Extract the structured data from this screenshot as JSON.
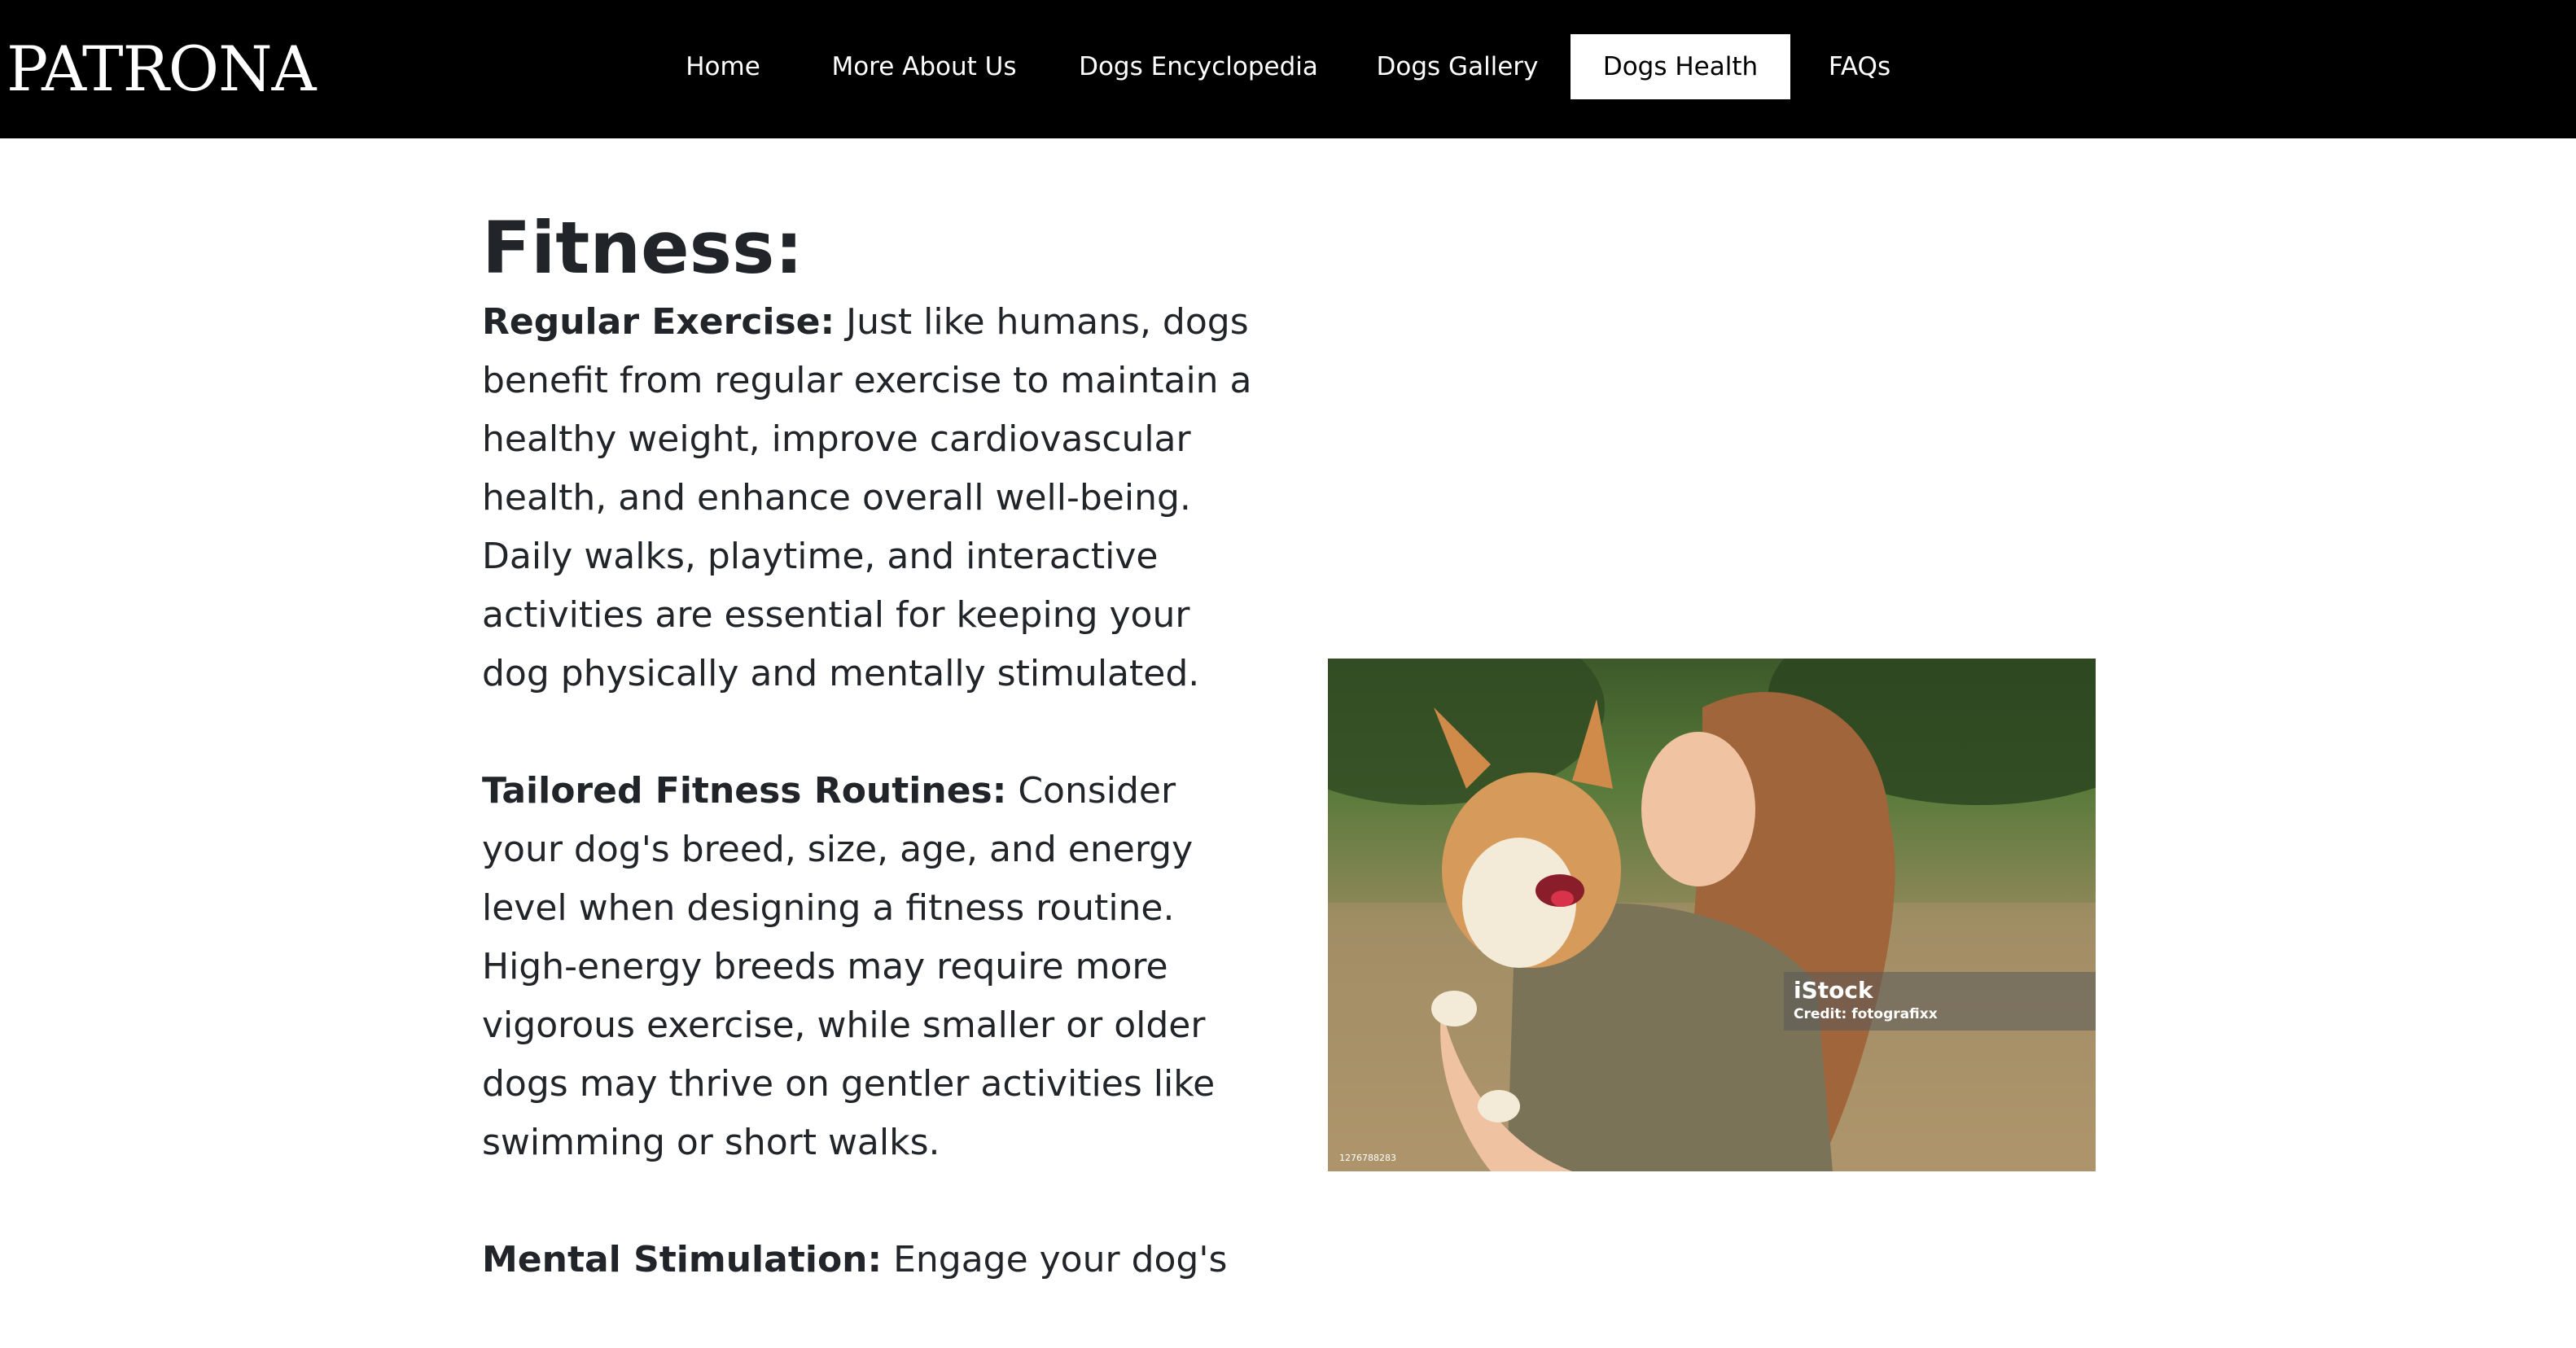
{
  "navbar": {
    "brand": "PATRONA",
    "items": [
      {
        "label": "Home",
        "active": false
      },
      {
        "label": "More About Us",
        "active": false
      },
      {
        "label": "Dogs Encyclopedia",
        "active": false
      },
      {
        "label": "Dogs Gallery",
        "active": false
      },
      {
        "label": "Dogs Health",
        "active": true
      },
      {
        "label": "FAQs",
        "active": false
      }
    ],
    "colors": {
      "background": "#000000",
      "text": "#ffffff",
      "active_background": "#ffffff",
      "active_text": "#000000"
    }
  },
  "main": {
    "title": "Fitness:",
    "sections": [
      {
        "lead": "Regular Exercise:",
        "text": " Just like humans, dogs benefit from regular exercise to maintain a healthy weight, improve cardiovascular health, and enhance overall well-being. Daily walks, playtime, and interactive activities are essential for keeping your dog physically and mentally stimulated."
      },
      {
        "lead": "Tailored Fitness Routines:",
        "text": " Consider your dog's breed, size, age, and energy level when designing a fitness routine. High-energy breeds may require more vigorous exercise, while smaller or older dogs may thrive on gentler activities like swimming or short walks."
      },
      {
        "lead": "Mental Stimulation:",
        "text": " Engage your dog's"
      }
    ],
    "image": {
      "watermark_brand": "iStock",
      "watermark_credit": "Credit: fotografixx",
      "photo_id": "1276788283"
    }
  }
}
